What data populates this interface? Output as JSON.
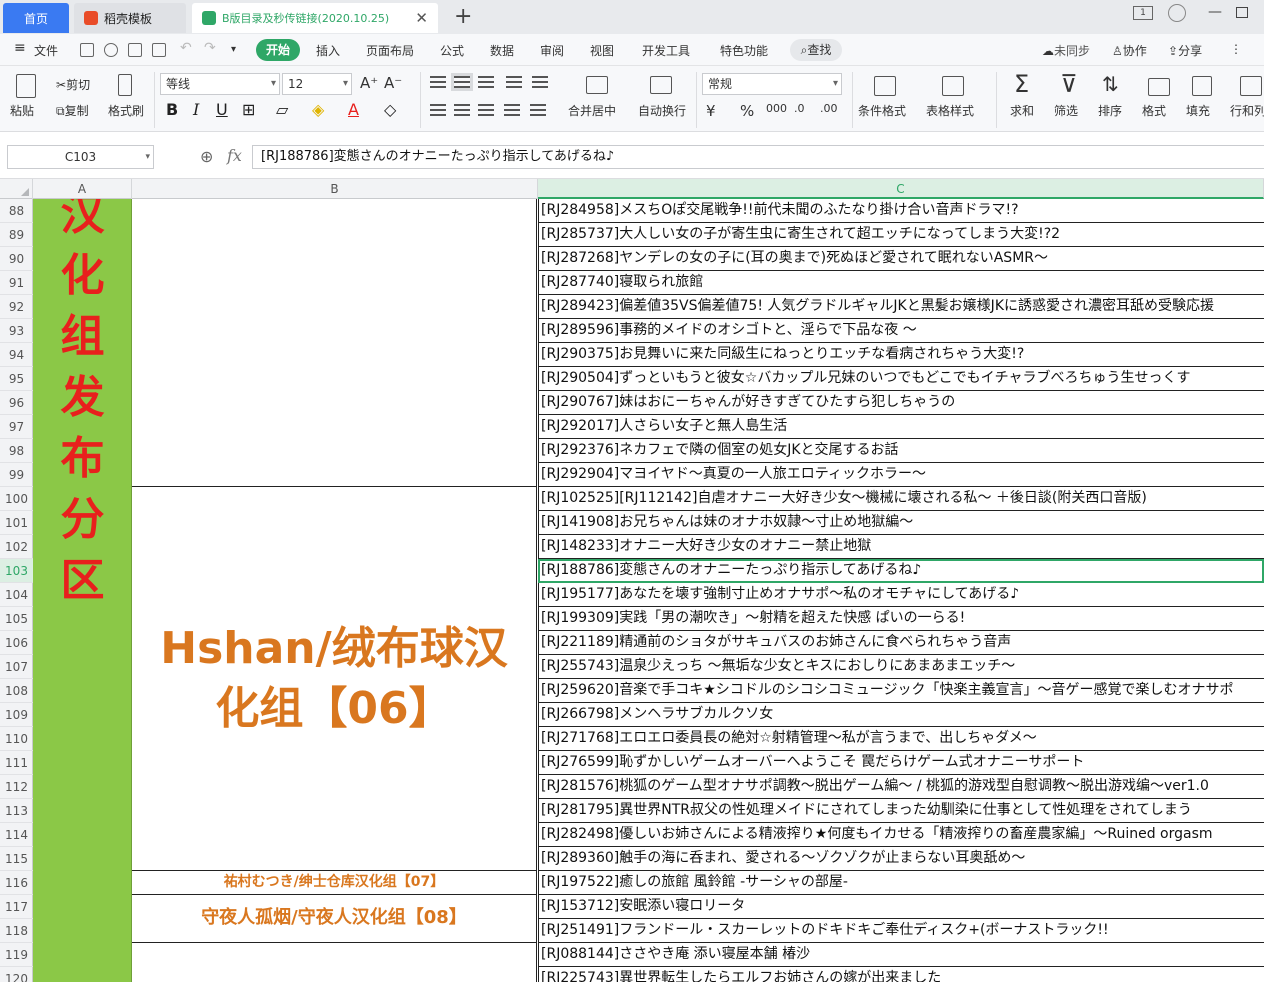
{
  "tabs": {
    "home": "首页",
    "template": "稻壳模板",
    "document": "B版目录及秒传链接(2020.10.25)"
  },
  "menu": {
    "file": "文件",
    "start": "开始",
    "insert": "插入",
    "page_layout": "页面布局",
    "formula": "公式",
    "data": "数据",
    "review": "审阅",
    "view": "视图",
    "developer": "开发工具",
    "special": "特色功能",
    "search": "查找",
    "unsynced": "未同步",
    "collab": "协作",
    "share": "分享"
  },
  "ribbon": {
    "paste": "粘贴",
    "cut": "剪切",
    "copy": "复制",
    "format_painter": "格式刷",
    "font_name": "等线",
    "font_size": "12",
    "merge_center": "合并居中",
    "wrap_text": "自动换行",
    "number_format": "常规",
    "cond_format": "条件格式",
    "table_style": "表格样式",
    "sum": "求和",
    "filter": "筛选",
    "sort": "排序",
    "format": "格式",
    "fill": "填充",
    "rows_cols": "行和列"
  },
  "formula_bar": {
    "cell_ref": "C103",
    "fx": "fx",
    "content": "[RJ188786]変態さんのオナニーたっぷり指示してあげるね♪"
  },
  "columns": [
    "A",
    "B",
    "C"
  ],
  "colA_chars": [
    "汉",
    "化",
    "组",
    "发",
    "布",
    "分",
    "区"
  ],
  "colB_blocks": [
    {
      "text": ""
    },
    {
      "text": "Hshan/绒布球汉化组【06】"
    },
    {
      "text": "祐村むつき/绅士仓库汉化组【07】"
    },
    {
      "text": "守夜人孤烟/守夜人汉化组【08】"
    },
    {
      "text": ""
    }
  ],
  "rows": [
    {
      "num": "88",
      "c": "[RJ284958]メスちOぽ交尾戦争!!前代未聞のふたなり掛け合い音声ドラマ!?"
    },
    {
      "num": "89",
      "c": "[RJ285737]大人しい女の子が寄生虫に寄生されて超エッチになってしまう大変!?2"
    },
    {
      "num": "90",
      "c": "[RJ287268]ヤンデレの女の子に(耳の奥まで)死ぬほど愛されて眠れないASMR～"
    },
    {
      "num": "91",
      "c": "[RJ287740]寝取られ旅館"
    },
    {
      "num": "92",
      "c": "[RJ289423]偏差値35VS偏差値75! 人気グラドルギャルJKと黒髪お嬢様JKに誘惑愛され濃密耳舐め受験応援"
    },
    {
      "num": "93",
      "c": "[RJ289596]事務的メイドのオシゴトと、淫らで下品な夜 ～"
    },
    {
      "num": "94",
      "c": "[RJ290375]お見舞いに来た同級生にねっとりエッチな看病されちゃう大変!?"
    },
    {
      "num": "95",
      "c": "[RJ290504]ずっといもうと彼女☆バカップル兄妹のいつでもどこでもイチャラブべろちゅう生せっくす"
    },
    {
      "num": "96",
      "c": "[RJ290767]妹はおにーちゃんが好きすぎてひたすら犯しちゃうの"
    },
    {
      "num": "97",
      "c": "[RJ292017]人さらい女子と無人島生活"
    },
    {
      "num": "98",
      "c": "[RJ292376]ネカフェで隣の個室の処女JKと交尾するお話"
    },
    {
      "num": "99",
      "c": "[RJ292904]マヨイヤド～真夏の一人旅エロティックホラー～"
    },
    {
      "num": "100",
      "c": "[RJ102525][RJ112142]自虐オナニー大好き少女～機械に壊される私～ ＋後日談(附关西口音版)"
    },
    {
      "num": "101",
      "c": "[RJ141908]お兄ちゃんは妹のオナホ奴隷～寸止め地獄編～"
    },
    {
      "num": "102",
      "c": "[RJ148233]オナニー大好き少女のオナニー禁止地獄"
    },
    {
      "num": "103",
      "c": "[RJ188786]変態さんのオナニーたっぷり指示してあげるね♪"
    },
    {
      "num": "104",
      "c": "[RJ195177]あなたを壊す強制寸止めオナサポ～私のオモチャにしてあげる♪"
    },
    {
      "num": "105",
      "c": "[RJ199309]実践「男の潮吹き」～射精を超えた快感 ぱいの一らる!"
    },
    {
      "num": "106",
      "c": "[RJ221189]精通前のショタがサキュバスのお姉さんに食べられちゃう音声"
    },
    {
      "num": "107",
      "c": "[RJ255743]温泉少えっち ～無垢な少女とキスにおしりにあまあまエッチ～"
    },
    {
      "num": "108",
      "c": "[RJ259620]音楽で手コキ★シコドルのシコシコミュージック「快楽主義宣言」〜音ゲー感覚で楽しむオナサポ"
    },
    {
      "num": "109",
      "c": "[RJ266798]メンヘラサブカルクソ女"
    },
    {
      "num": "110",
      "c": "[RJ271768]エロエロ委員長の絶対☆射精管理～私が言うまで、出しちゃダメ～"
    },
    {
      "num": "111",
      "c": "[RJ276599]恥ずかしいゲームオーバーへようこそ 罠だらけゲーム式オナニーサポート"
    },
    {
      "num": "112",
      "c": "[RJ281576]桃狐のゲーム型オナサポ調教～脱出ゲーム編～ / 桃狐的游戏型自慰调教～脱出游戏编～ver1.0"
    },
    {
      "num": "113",
      "c": "[RJ281795]異世界NTR叔父の性処理メイドにされてしまった幼馴染に仕事として性処理をされてしまう"
    },
    {
      "num": "114",
      "c": "[RJ282498]優しいお姉さんによる精液搾り★何度もイカせる「精液搾りの畜産農家編」〜Ruined orgasm"
    },
    {
      "num": "115",
      "c": "[RJ289360]触手の海に呑まれ、愛される～ゾクゾクが止まらない耳奥舐め～"
    },
    {
      "num": "116",
      "c": "[RJ197522]癒しの旅館 風鈴館 -サーシャの部屋-"
    },
    {
      "num": "117",
      "c": "[RJ153712]安眠添い寝ロリータ"
    },
    {
      "num": "118",
      "c": "[RJ251491]フランドール・スカーレットのドキドキご奉仕ディスク+(ボーナストラック!!"
    },
    {
      "num": "119",
      "c": "[RJ088144]ささやき庵 添い寝屋本舗 椿沙"
    },
    {
      "num": "120",
      "c": "[RJ225743]異世界転生したらエルフお姉さんの嫁が出来ました"
    }
  ],
  "colors": {
    "accent": "#2fa767",
    "colA_fill": "#8bc847",
    "colA_text": "#e8201d",
    "colB_text": "#d9771f"
  }
}
